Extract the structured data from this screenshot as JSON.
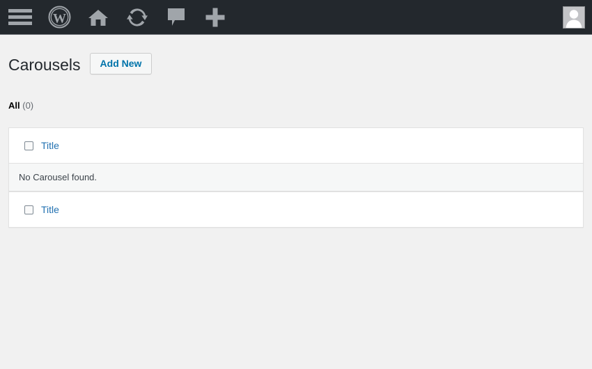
{
  "adminbar": {
    "items": [
      {
        "name": "menu-toggle-icon",
        "label": "Menu"
      },
      {
        "name": "wordpress-logo-icon",
        "label": "About WordPress"
      },
      {
        "name": "home-icon",
        "label": "Visit Site"
      },
      {
        "name": "updates-icon",
        "label": "Updates"
      },
      {
        "name": "comments-icon",
        "label": "Comments"
      },
      {
        "name": "new-content-icon",
        "label": "New"
      }
    ],
    "avatar_label": "My Account",
    "background_color": "#23282d",
    "icon_color": "#a0a5aa"
  },
  "page": {
    "title": "Carousels",
    "add_new_label": "Add New",
    "accent_color": "#0073aa",
    "link_color": "#2271b1",
    "background_color": "#f1f1f1"
  },
  "filters": {
    "all_label": "All",
    "all_count": "(0)"
  },
  "table": {
    "header": {
      "title_column": "Title"
    },
    "footer": {
      "title_column": "Title"
    },
    "empty_message": "No Carousel found."
  }
}
